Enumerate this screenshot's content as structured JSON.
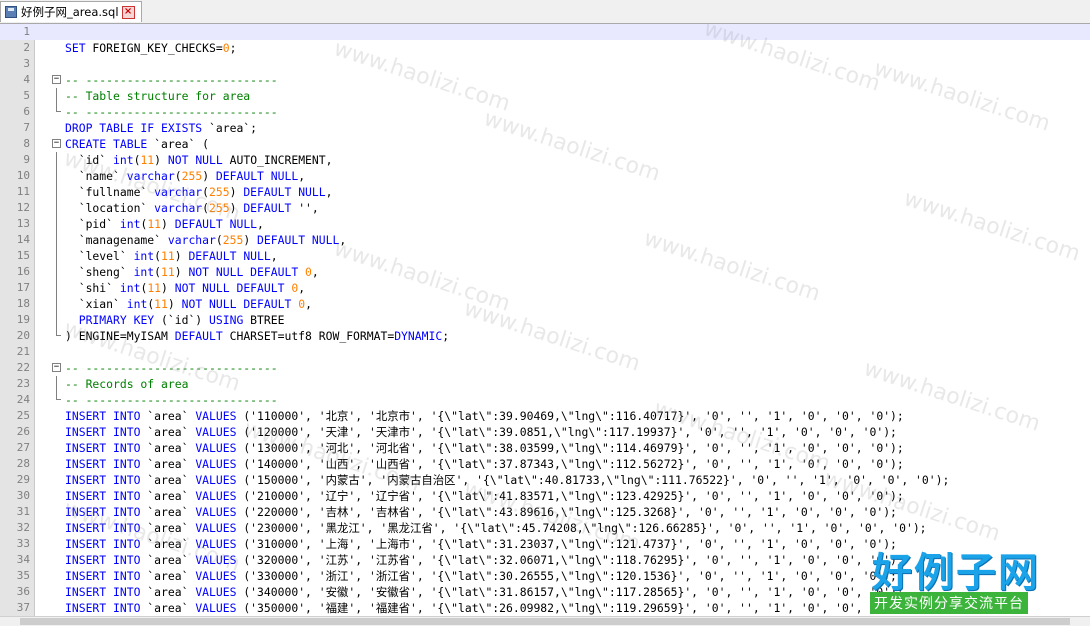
{
  "tab": {
    "title": "好例子网_area.sql"
  },
  "watermarks": [
    "www.haolizi.com"
  ],
  "logo": {
    "main": "好例子网",
    "sub": "开发实例分享交流平台"
  },
  "lines": [
    {
      "n": "1",
      "t": []
    },
    {
      "n": "2",
      "t": [
        [
          "kw",
          "SET"
        ],
        [
          "op",
          " FOREIGN_KEY_CHECKS="
        ],
        [
          "num",
          "0"
        ],
        [
          "op",
          ";"
        ]
      ]
    },
    {
      "n": "3",
      "t": []
    },
    {
      "n": "4",
      "t": [
        [
          "cm",
          "-- ----------------------------"
        ]
      ],
      "fold": "box"
    },
    {
      "n": "5",
      "t": [
        [
          "cm",
          "-- Table structure for area"
        ]
      ],
      "fold": "line"
    },
    {
      "n": "6",
      "t": [
        [
          "cm",
          "-- ----------------------------"
        ]
      ],
      "fold": "end"
    },
    {
      "n": "7",
      "t": [
        [
          "kw",
          "DROP TABLE IF EXISTS"
        ],
        [
          "op",
          " `area`;"
        ]
      ]
    },
    {
      "n": "8",
      "t": [
        [
          "kw",
          "CREATE TABLE"
        ],
        [
          "op",
          " `area` ("
        ]
      ],
      "fold": "box"
    },
    {
      "n": "9",
      "t": [
        [
          "op",
          "  `id` "
        ],
        [
          "ty",
          "int"
        ],
        [
          "op",
          "("
        ],
        [
          "num",
          "11"
        ],
        [
          "op",
          ") "
        ],
        [
          "kw",
          "NOT NULL"
        ],
        [
          "op",
          " AUTO_INCREMENT,"
        ]
      ],
      "fold": "line"
    },
    {
      "n": "10",
      "t": [
        [
          "op",
          "  `name` "
        ],
        [
          "ty",
          "varchar"
        ],
        [
          "op",
          "("
        ],
        [
          "num",
          "255"
        ],
        [
          "op",
          ") "
        ],
        [
          "kw",
          "DEFAULT NULL"
        ],
        [
          "op",
          ","
        ]
      ],
      "fold": "line"
    },
    {
      "n": "11",
      "t": [
        [
          "op",
          "  `fullname` "
        ],
        [
          "ty",
          "varchar"
        ],
        [
          "op",
          "("
        ],
        [
          "num",
          "255"
        ],
        [
          "op",
          ") "
        ],
        [
          "kw",
          "DEFAULT NULL"
        ],
        [
          "op",
          ","
        ]
      ],
      "fold": "line"
    },
    {
      "n": "12",
      "t": [
        [
          "op",
          "  `location` "
        ],
        [
          "ty",
          "varchar"
        ],
        [
          "op",
          "("
        ],
        [
          "num",
          "255"
        ],
        [
          "op",
          ") "
        ],
        [
          "kw",
          "DEFAULT"
        ],
        [
          "op",
          " '',"
        ]
      ],
      "fold": "line"
    },
    {
      "n": "13",
      "t": [
        [
          "op",
          "  `pid` "
        ],
        [
          "ty",
          "int"
        ],
        [
          "op",
          "("
        ],
        [
          "num",
          "11"
        ],
        [
          "op",
          ") "
        ],
        [
          "kw",
          "DEFAULT NULL"
        ],
        [
          "op",
          ","
        ]
      ],
      "fold": "line"
    },
    {
      "n": "14",
      "t": [
        [
          "op",
          "  `managename` "
        ],
        [
          "ty",
          "varchar"
        ],
        [
          "op",
          "("
        ],
        [
          "num",
          "255"
        ],
        [
          "op",
          ") "
        ],
        [
          "kw",
          "DEFAULT NULL"
        ],
        [
          "op",
          ","
        ]
      ],
      "fold": "line"
    },
    {
      "n": "15",
      "t": [
        [
          "op",
          "  `level` "
        ],
        [
          "ty",
          "int"
        ],
        [
          "op",
          "("
        ],
        [
          "num",
          "11"
        ],
        [
          "op",
          ") "
        ],
        [
          "kw",
          "DEFAULT NULL"
        ],
        [
          "op",
          ","
        ]
      ],
      "fold": "line"
    },
    {
      "n": "16",
      "t": [
        [
          "op",
          "  `sheng` "
        ],
        [
          "ty",
          "int"
        ],
        [
          "op",
          "("
        ],
        [
          "num",
          "11"
        ],
        [
          "op",
          ") "
        ],
        [
          "kw",
          "NOT NULL DEFAULT"
        ],
        [
          "op",
          " "
        ],
        [
          "num",
          "0"
        ],
        [
          "op",
          ","
        ]
      ],
      "fold": "line"
    },
    {
      "n": "17",
      "t": [
        [
          "op",
          "  `shi` "
        ],
        [
          "ty",
          "int"
        ],
        [
          "op",
          "("
        ],
        [
          "num",
          "11"
        ],
        [
          "op",
          ") "
        ],
        [
          "kw",
          "NOT NULL DEFAULT"
        ],
        [
          "op",
          " "
        ],
        [
          "num",
          "0"
        ],
        [
          "op",
          ","
        ]
      ],
      "fold": "line"
    },
    {
      "n": "18",
      "t": [
        [
          "op",
          "  `xian` "
        ],
        [
          "ty",
          "int"
        ],
        [
          "op",
          "("
        ],
        [
          "num",
          "11"
        ],
        [
          "op",
          ") "
        ],
        [
          "kw",
          "NOT NULL DEFAULT"
        ],
        [
          "op",
          " "
        ],
        [
          "num",
          "0"
        ],
        [
          "op",
          ","
        ]
      ],
      "fold": "line"
    },
    {
      "n": "19",
      "t": [
        [
          "op",
          "  "
        ],
        [
          "kw",
          "PRIMARY KEY"
        ],
        [
          "op",
          " (`id`) "
        ],
        [
          "kw",
          "USING"
        ],
        [
          "op",
          " BTREE"
        ]
      ],
      "fold": "line"
    },
    {
      "n": "20",
      "t": [
        [
          "op",
          ") ENGINE=MyISAM "
        ],
        [
          "kw",
          "DEFAULT"
        ],
        [
          "op",
          " CHARSET=utf8 ROW_FORMAT="
        ],
        [
          "kw",
          "DYNAMIC"
        ],
        [
          "op",
          ";"
        ]
      ],
      "fold": "end"
    },
    {
      "n": "21",
      "t": []
    },
    {
      "n": "22",
      "t": [
        [
          "cm",
          "-- ----------------------------"
        ]
      ],
      "fold": "box"
    },
    {
      "n": "23",
      "t": [
        [
          "cm",
          "-- Records of area"
        ]
      ],
      "fold": "line"
    },
    {
      "n": "24",
      "t": [
        [
          "cm",
          "-- ----------------------------"
        ]
      ],
      "fold": "end"
    },
    {
      "n": "25",
      "t": [
        [
          "kw",
          "INSERT INTO"
        ],
        [
          "op",
          " `area` "
        ],
        [
          "kw",
          "VALUES"
        ],
        [
          "op",
          " ('110000', '北京', '北京市', '{\\\"lat\\\":39.90469,\\\"lng\\\":116.40717}', '0', '', '1', '0', '0', '0');"
        ]
      ]
    },
    {
      "n": "26",
      "t": [
        [
          "kw",
          "INSERT INTO"
        ],
        [
          "op",
          " `area` "
        ],
        [
          "kw",
          "VALUES"
        ],
        [
          "op",
          " ('120000', '天津', '天津市', '{\\\"lat\\\":39.0851,\\\"lng\\\":117.19937}', '0', '', '1', '0', '0', '0');"
        ]
      ]
    },
    {
      "n": "27",
      "t": [
        [
          "kw",
          "INSERT INTO"
        ],
        [
          "op",
          " `area` "
        ],
        [
          "kw",
          "VALUES"
        ],
        [
          "op",
          " ('130000', '河北', '河北省', '{\\\"lat\\\":38.03599,\\\"lng\\\":114.46979}', '0', '', '1', '0', '0', '0');"
        ]
      ]
    },
    {
      "n": "28",
      "t": [
        [
          "kw",
          "INSERT INTO"
        ],
        [
          "op",
          " `area` "
        ],
        [
          "kw",
          "VALUES"
        ],
        [
          "op",
          " ('140000', '山西', '山西省', '{\\\"lat\\\":37.87343,\\\"lng\\\":112.56272}', '0', '', '1', '0', '0', '0');"
        ]
      ]
    },
    {
      "n": "29",
      "t": [
        [
          "kw",
          "INSERT INTO"
        ],
        [
          "op",
          " `area` "
        ],
        [
          "kw",
          "VALUES"
        ],
        [
          "op",
          " ('150000', '内蒙古', '内蒙古自治区', '{\\\"lat\\\":40.81733,\\\"lng\\\":111.76522}', '0', '', '1', '0', '0', '0');"
        ]
      ]
    },
    {
      "n": "30",
      "t": [
        [
          "kw",
          "INSERT INTO"
        ],
        [
          "op",
          " `area` "
        ],
        [
          "kw",
          "VALUES"
        ],
        [
          "op",
          " ('210000', '辽宁', '辽宁省', '{\\\"lat\\\":41.83571,\\\"lng\\\":123.42925}', '0', '', '1', '0', '0', '0');"
        ]
      ]
    },
    {
      "n": "31",
      "t": [
        [
          "kw",
          "INSERT INTO"
        ],
        [
          "op",
          " `area` "
        ],
        [
          "kw",
          "VALUES"
        ],
        [
          "op",
          " ('220000', '吉林', '吉林省', '{\\\"lat\\\":43.89616,\\\"lng\\\":125.3268}', '0', '', '1', '0', '0', '0');"
        ]
      ]
    },
    {
      "n": "32",
      "t": [
        [
          "kw",
          "INSERT INTO"
        ],
        [
          "op",
          " `area` "
        ],
        [
          "kw",
          "VALUES"
        ],
        [
          "op",
          " ('230000', '黑龙江', '黑龙江省', '{\\\"lat\\\":45.74208,\\\"lng\\\":126.66285}', '0', '', '1', '0', '0', '0');"
        ]
      ]
    },
    {
      "n": "33",
      "t": [
        [
          "kw",
          "INSERT INTO"
        ],
        [
          "op",
          " `area` "
        ],
        [
          "kw",
          "VALUES"
        ],
        [
          "op",
          " ('310000', '上海', '上海市', '{\\\"lat\\\":31.23037,\\\"lng\\\":121.4737}', '0', '', '1', '0', '0', '0');"
        ]
      ]
    },
    {
      "n": "34",
      "t": [
        [
          "kw",
          "INSERT INTO"
        ],
        [
          "op",
          " `area` "
        ],
        [
          "kw",
          "VALUES"
        ],
        [
          "op",
          " ('320000', '江苏', '江苏省', '{\\\"lat\\\":32.06071,\\\"lng\\\":118.76295}', '0', '', '1', '0', '0', '0');"
        ]
      ]
    },
    {
      "n": "35",
      "t": [
        [
          "kw",
          "INSERT INTO"
        ],
        [
          "op",
          " `area` "
        ],
        [
          "kw",
          "VALUES"
        ],
        [
          "op",
          " ('330000', '浙江', '浙江省', '{\\\"lat\\\":30.26555,\\\"lng\\\":120.1536}', '0', '', '1', '0', '0', '0');"
        ]
      ]
    },
    {
      "n": "36",
      "t": [
        [
          "kw",
          "INSERT INTO"
        ],
        [
          "op",
          " `area` "
        ],
        [
          "kw",
          "VALUES"
        ],
        [
          "op",
          " ('340000', '安徽', '安徽省', '{\\\"lat\\\":31.86157,\\\"lng\\\":117.28565}', '0', '', '1', '0', '0', '0');"
        ]
      ]
    },
    {
      "n": "37",
      "t": [
        [
          "kw",
          "INSERT INTO"
        ],
        [
          "op",
          " `area` "
        ],
        [
          "kw",
          "VALUES"
        ],
        [
          "op",
          " ('350000', '福建', '福建省', '{\\\"lat\\\":26.09982,\\\"lng\\\":119.29659}', '0', '', '1', '0', '0', '0');"
        ]
      ]
    }
  ]
}
